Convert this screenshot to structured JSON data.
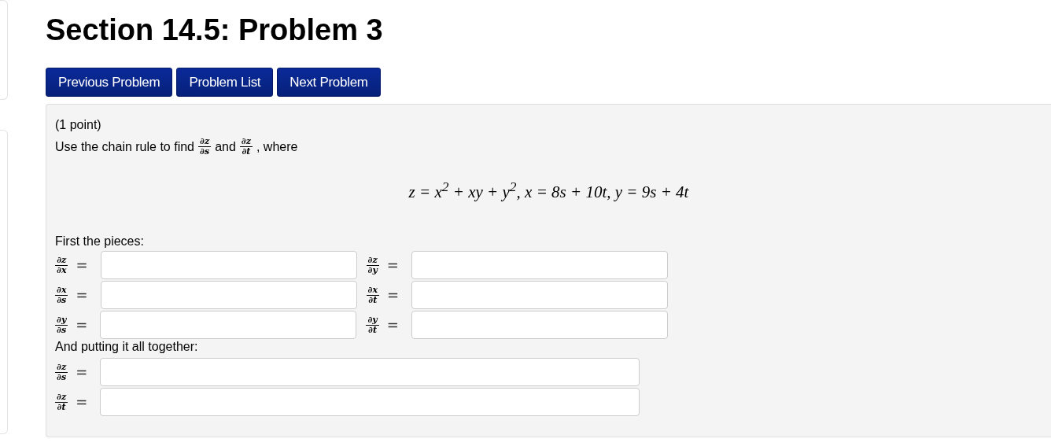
{
  "title": "Section 14.5: Problem 3",
  "nav_buttons": [
    "Previous Problem",
    "Problem List",
    "Next Problem"
  ],
  "problem": {
    "points": "(1 point)",
    "intro": [
      {
        "kind": "text",
        "text": "Use the chain rule to find"
      },
      {
        "kind": "fraction",
        "numerator": "∂z",
        "denominator": "∂s"
      },
      {
        "kind": "text",
        "text": "and"
      },
      {
        "kind": "fraction",
        "numerator": "∂z",
        "denominator": "∂t"
      },
      {
        "kind": "text",
        "text": ", where"
      }
    ],
    "equation": "z = x$^{2}$ + xy + y$^{2}$, x = 8s + 10t, y = 9s + 4t",
    "pieces_label": "First the pieces:",
    "pieces": [
      [
        {
          "numerator": "∂z",
          "denominator": "∂x",
          "equals": "="
        },
        {
          "numerator": "∂z",
          "denominator": "∂y",
          "equals": "="
        }
      ],
      [
        {
          "numerator": "∂x",
          "denominator": "∂s",
          "equals": "="
        },
        {
          "numerator": "∂x",
          "denominator": "∂t",
          "equals": "="
        }
      ],
      [
        {
          "numerator": "∂y",
          "denominator": "∂s",
          "equals": "="
        },
        {
          "numerator": "∂y",
          "denominator": "∂t",
          "equals": "="
        }
      ]
    ],
    "together_label": "And putting it all together:",
    "answers": [
      {
        "numerator": "∂z",
        "denominator": "∂s",
        "equals": "="
      },
      {
        "numerator": "∂z",
        "denominator": "∂t",
        "equals": "="
      }
    ]
  }
}
